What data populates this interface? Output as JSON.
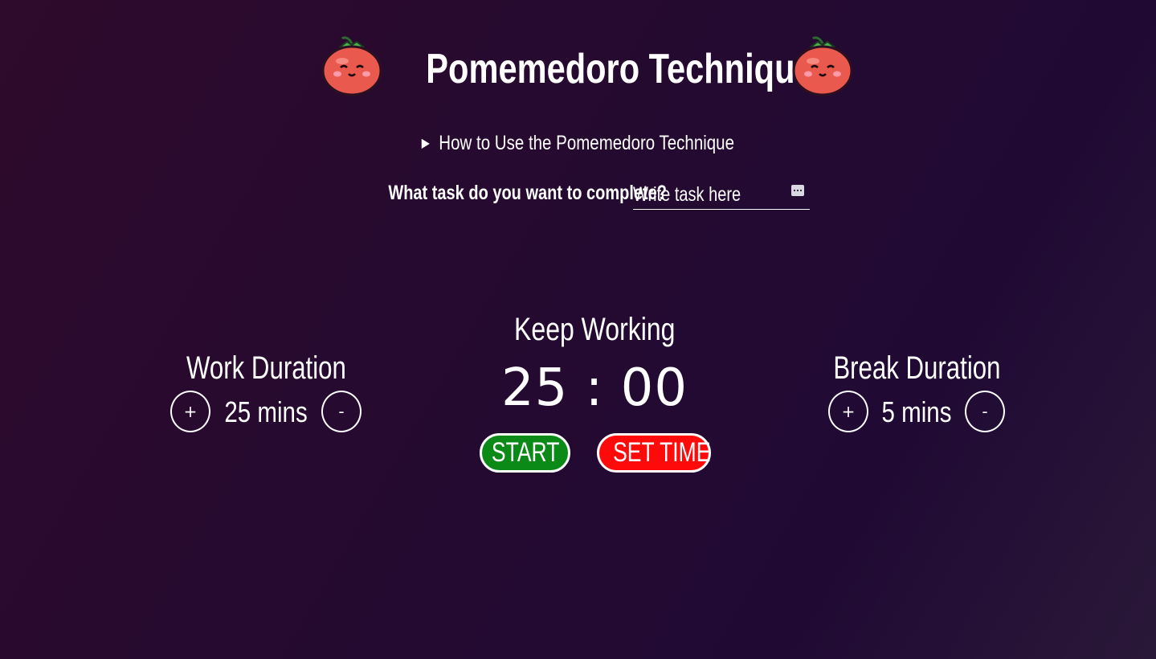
{
  "app": {
    "title": "Pomemedoro Technique",
    "tomato_icon": "tomato-face-icon"
  },
  "howto": {
    "arrow": "▶",
    "label": "How to Use the Pomemedoro Technique"
  },
  "task": {
    "label": "What task do you want to complete?",
    "placeholder": "Write task here",
    "value": ""
  },
  "work": {
    "title": "Work Duration",
    "plus": "+",
    "minus": "-",
    "value": "25 mins"
  },
  "break": {
    "title": "Break Duration",
    "plus": "+",
    "minus": "-",
    "value": "5 mins"
  },
  "timer": {
    "status": "Keep Working",
    "display": "25 : 00"
  },
  "buttons": {
    "start": "START",
    "set_time": "SET TIME"
  },
  "colors": {
    "start": "#0b8a17",
    "set_time": "#ff0a0a",
    "tomato": "#e9594e"
  }
}
